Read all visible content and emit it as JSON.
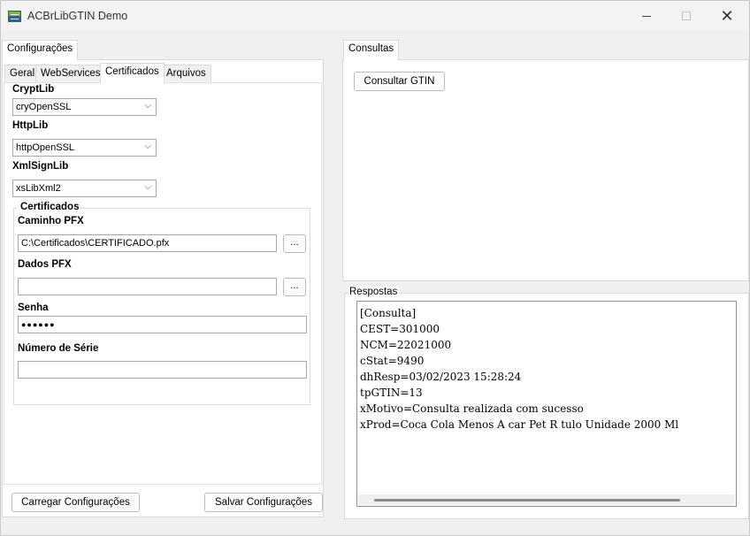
{
  "window": {
    "title": "ACBrLibGTIN Demo"
  },
  "left": {
    "top_tab": "Configurações",
    "sub_tabs": [
      "Geral",
      "WebServices",
      "Certificados",
      "Arquivos"
    ],
    "crypt": {
      "label": "CryptLib",
      "value": "cryOpenSSL"
    },
    "http": {
      "label": "HttpLib",
      "value": "httpOpenSSL"
    },
    "xmlsign": {
      "label": "XmlSignLib",
      "value": "xsLibXml2"
    },
    "cert": {
      "title": "Certificados",
      "pfx_label": "Caminho PFX",
      "pfx_value": "C:\\Certificados\\CERTIFICADO.pfx",
      "browse": "...",
      "dados_label": "Dados PFX",
      "dados_value": "",
      "senha_label": "Senha",
      "senha_value": "●●●●●●",
      "serie_label": "Número de Série",
      "serie_value": ""
    },
    "load_button": "Carregar Configurações",
    "save_button": "Salvar Configurações"
  },
  "right": {
    "tab": "Consultas",
    "query_button": "Consultar GTIN",
    "responses_label": "Respostas",
    "responses": [
      "[Consulta]",
      "CEST=301000",
      "NCM=22021000",
      "cStat=9490",
      "dhResp=03/02/2023 15:28:24",
      "tpGTIN=13",
      "xMotivo=Consulta realizada com sucesso",
      "xProd=Coca Cola Menos A car Pet R tulo Unidade 2000 Ml"
    ]
  }
}
